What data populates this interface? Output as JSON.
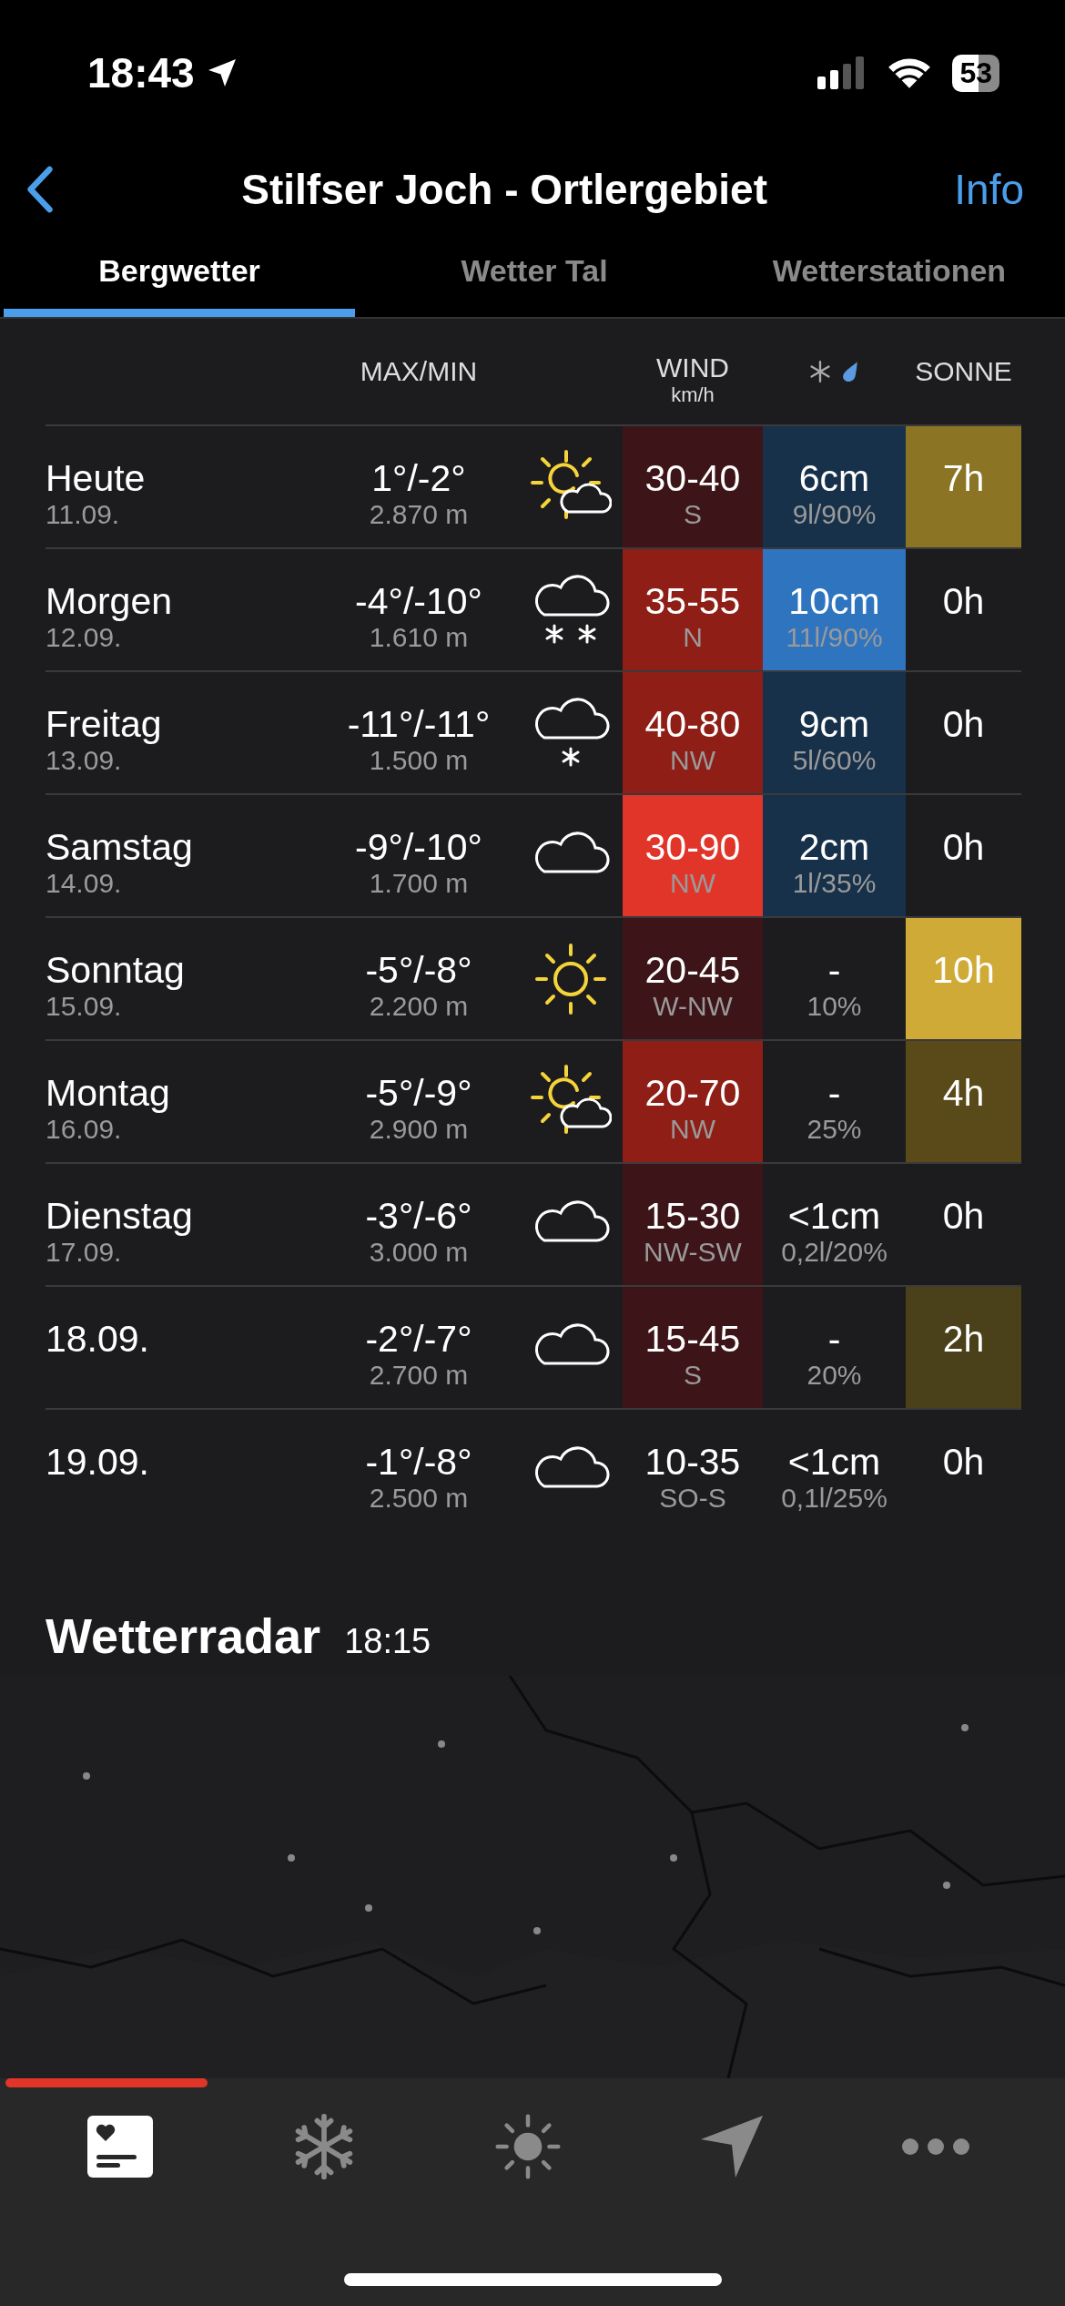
{
  "status_bar": {
    "time": "18:43",
    "battery": "53"
  },
  "nav": {
    "title": "Stilfser Joch - Ortlergebiet",
    "action": "Info"
  },
  "tabs": [
    {
      "label": "Bergwetter",
      "selected": true
    },
    {
      "label": "Wetter Tal",
      "selected": false
    },
    {
      "label": "Wetterstationen",
      "selected": false
    }
  ],
  "table": {
    "columns": {
      "temp": "MAX/MIN",
      "wind": "WIND",
      "wind_unit": "km/h",
      "sun": "SONNE"
    },
    "rows": [
      {
        "day": "Heute",
        "date": "11.09.",
        "temp": "1°/-2°",
        "altitude": "2.870 m",
        "kind": "partly_sunny",
        "wind": {
          "speed": "30-40",
          "dir": "S",
          "color": "#3d1417"
        },
        "precip": {
          "amount": "6cm",
          "detail": "9l/90%",
          "color": "#17314a"
        },
        "sun": {
          "hours": "7h",
          "color": "#8b7424"
        }
      },
      {
        "day": "Morgen",
        "date": "12.09.",
        "temp": "-4°/-10°",
        "altitude": "1.610 m",
        "kind": "snow_heavy",
        "wind": {
          "speed": "35-55",
          "dir": "N",
          "color": "#8e1e16"
        },
        "precip": {
          "amount": "10cm",
          "detail": "11l/90%",
          "color": "#2f74bf"
        },
        "sun": {
          "hours": "0h"
        }
      },
      {
        "day": "Freitag",
        "date": "13.09.",
        "temp": "-11°/-11°",
        "altitude": "1.500 m",
        "kind": "snow",
        "wind": {
          "speed": "40-80",
          "dir": "NW",
          "color": "#8e1e16"
        },
        "precip": {
          "amount": "9cm",
          "detail": "5l/60%",
          "color": "#17314a"
        },
        "sun": {
          "hours": "0h"
        }
      },
      {
        "day": "Samstag",
        "date": "14.09.",
        "temp": "-9°/-10°",
        "altitude": "1.700 m",
        "kind": "cloudy",
        "wind": {
          "speed": "30-90",
          "dir": "NW",
          "color": "#e2352a"
        },
        "precip": {
          "amount": "2cm",
          "detail": "1l/35%",
          "color": "#17314a"
        },
        "sun": {
          "hours": "0h"
        }
      },
      {
        "day": "Sonntag",
        "date": "15.09.",
        "temp": "-5°/-8°",
        "altitude": "2.200 m",
        "kind": "sunny",
        "wind": {
          "speed": "20-45",
          "dir": "W-NW",
          "color": "#3d1417"
        },
        "precip": {
          "amount": "-",
          "detail": "10%"
        },
        "sun": {
          "hours": "10h",
          "color": "#cfaa37"
        }
      },
      {
        "day": "Montag",
        "date": "16.09.",
        "temp": "-5°/-9°",
        "altitude": "2.900 m",
        "kind": "partly_sunny",
        "wind": {
          "speed": "20-70",
          "dir": "NW",
          "color": "#8e1e16"
        },
        "precip": {
          "amount": "-",
          "detail": "25%"
        },
        "sun": {
          "hours": "4h",
          "color": "#5a4a1a"
        }
      },
      {
        "day": "Dienstag",
        "date": "17.09.",
        "temp": "-3°/-6°",
        "altitude": "3.000 m",
        "kind": "cloudy",
        "wind": {
          "speed": "15-30",
          "dir": "NW-SW",
          "color": "#3d1417"
        },
        "precip": {
          "amount": "<1cm",
          "detail": "0,2l/20%"
        },
        "sun": {
          "hours": "0h"
        }
      },
      {
        "day": "18.09.",
        "temp": "-2°/-7°",
        "altitude": "2.700 m",
        "kind": "cloudy",
        "wind": {
          "speed": "15-45",
          "dir": "S",
          "color": "#3d1417"
        },
        "precip": {
          "amount": "-",
          "detail": "20%"
        },
        "sun": {
          "hours": "2h",
          "color": "#4a401a"
        }
      },
      {
        "day": "19.09.",
        "temp": "-1°/-8°",
        "altitude": "2.500 m",
        "kind": "cloudy",
        "wind": {
          "speed": "10-35",
          "dir": "SO-S"
        },
        "precip": {
          "amount": "<1cm",
          "detail": "0,1l/25%"
        },
        "sun": {
          "hours": "0h"
        }
      }
    ]
  },
  "radar": {
    "title": "Wetterradar",
    "time": "18:15",
    "level": 0.19
  },
  "bottom_tabs": [
    {
      "kind": "favorites",
      "selected": true
    },
    {
      "kind": "snow",
      "selected": false
    },
    {
      "kind": "weather",
      "selected": false
    },
    {
      "kind": "location",
      "selected": false
    },
    {
      "kind": "more",
      "selected": false
    }
  ]
}
